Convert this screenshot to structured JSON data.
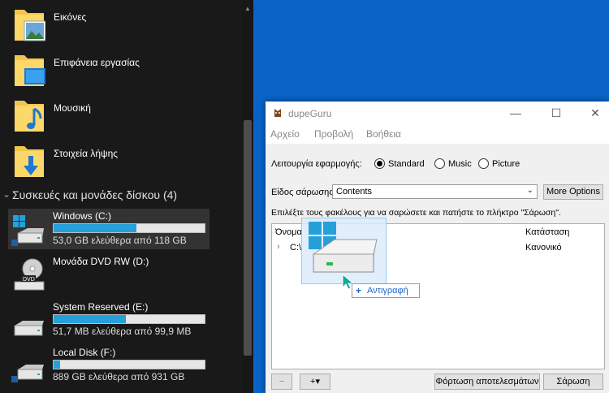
{
  "explorer": {
    "folders": [
      {
        "label": "Εικόνες",
        "icon": "pictures-folder-icon"
      },
      {
        "label": "Επιφάνεια εργασίας",
        "icon": "desktop-folder-icon"
      },
      {
        "label": "Μουσική",
        "icon": "music-folder-icon"
      },
      {
        "label": "Στοιχεία λήψης",
        "icon": "downloads-folder-icon"
      }
    ],
    "devices_header": "Συσκευές και μονάδες δίσκου (4)",
    "drives": [
      {
        "name": "Windows (C:)",
        "free": "53,0 GB ελεύθερα από 118 GB",
        "used_fraction": 0.55
      },
      {
        "name": "Μονάδα DVD RW (D:)",
        "free": "",
        "used_fraction": null
      },
      {
        "name": "System Reserved (E:)",
        "free": "51,7 MB ελεύθερα από 99,9 MB",
        "used_fraction": 0.48
      },
      {
        "name": "Local Disk (F:)",
        "free": "889 GB ελεύθερα από 931 GB",
        "used_fraction": 0.045
      }
    ]
  },
  "dupeguru": {
    "title": "dupeGuru",
    "menu": [
      "Αρχείο",
      "Προβολή",
      "Βοήθεια"
    ],
    "app_mode_label": "Λειτουργία εφαρμογής:",
    "modes": [
      {
        "label": "Standard",
        "checked": true
      },
      {
        "label": "Music",
        "checked": false
      },
      {
        "label": "Picture",
        "checked": false
      }
    ],
    "scan_type_label": "Είδος σάρωσης",
    "scan_type_value": "Contents",
    "more_options": "More Options",
    "instructions": "Επιλέξτε τους φακέλους για να σαρώσετε και πατήστε το πλήκτρο \"Σάρωση\".",
    "columns": {
      "name": "Όνομα",
      "state": "Κατάσταση"
    },
    "rows": [
      {
        "name": "C:\\",
        "state": "Κανονικό"
      }
    ],
    "remove_btn": "−",
    "add_btn": "+▾",
    "load_results": "Φόρτωση αποτελεσμάτων",
    "scan": "Σάρωση"
  },
  "drag": {
    "tooltip_plus": "+",
    "tooltip_text": "Αντιγραφή"
  }
}
